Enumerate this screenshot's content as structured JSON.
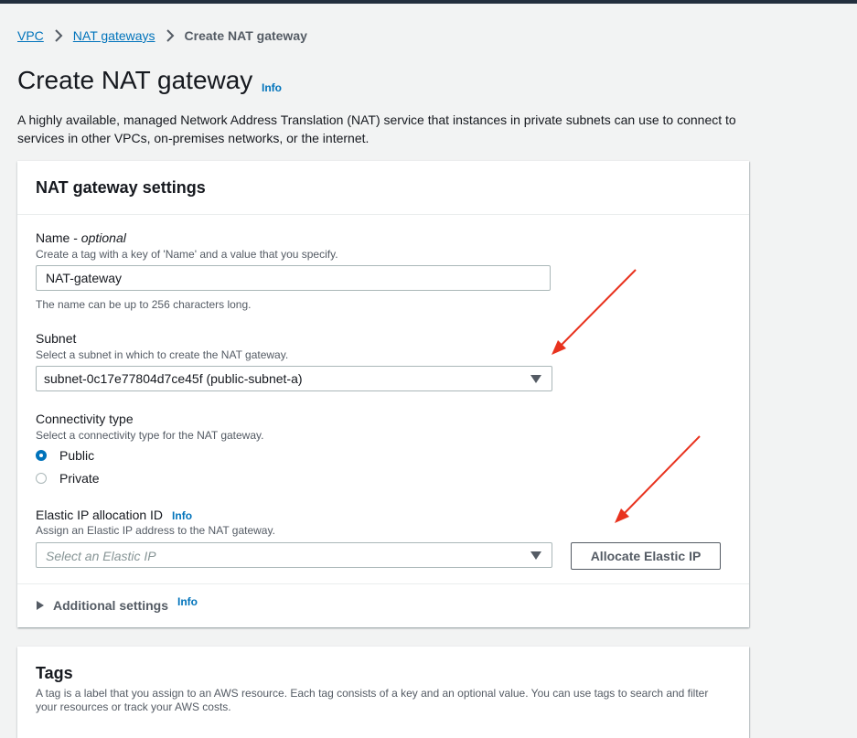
{
  "breadcrumb": {
    "items": [
      "VPC",
      "NAT gateways"
    ],
    "current": "Create NAT gateway"
  },
  "page": {
    "title": "Create NAT gateway",
    "info": "Info",
    "description": "A highly available, managed Network Address Translation (NAT) service that instances in private subnets can use to connect to services in other VPCs, on-premises networks, or the internet."
  },
  "settings": {
    "title": "NAT gateway settings",
    "name": {
      "label": "Name - ",
      "label_optional": "optional",
      "description": "Create a tag with a key of 'Name' and a value that you specify.",
      "value": "NAT-gateway",
      "constraint": "The name can be up to 256 characters long."
    },
    "subnet": {
      "label": "Subnet",
      "description": "Select a subnet in which to create the NAT gateway.",
      "value": "subnet-0c17e77804d7ce45f (public-subnet-a)"
    },
    "connectivity": {
      "label": "Connectivity type",
      "description": "Select a connectivity type for the NAT gateway.",
      "options": [
        "Public",
        "Private"
      ],
      "selected": "Public"
    },
    "elastic_ip": {
      "label": "Elastic IP allocation ID",
      "info": "Info",
      "description": "Assign an Elastic IP address to the NAT gateway.",
      "placeholder": "Select an Elastic IP",
      "button": "Allocate Elastic IP"
    },
    "additional": {
      "label": "Additional settings",
      "info": "Info"
    }
  },
  "tags": {
    "title": "Tags",
    "description": "A tag is a label that you assign to an AWS resource. Each tag consists of a key and an optional value. You can use tags to search and filter your resources or track your AWS costs."
  },
  "colors": {
    "link": "#0073bb",
    "annotation_arrow": "#e8321e",
    "topbar": "#232f3e"
  }
}
